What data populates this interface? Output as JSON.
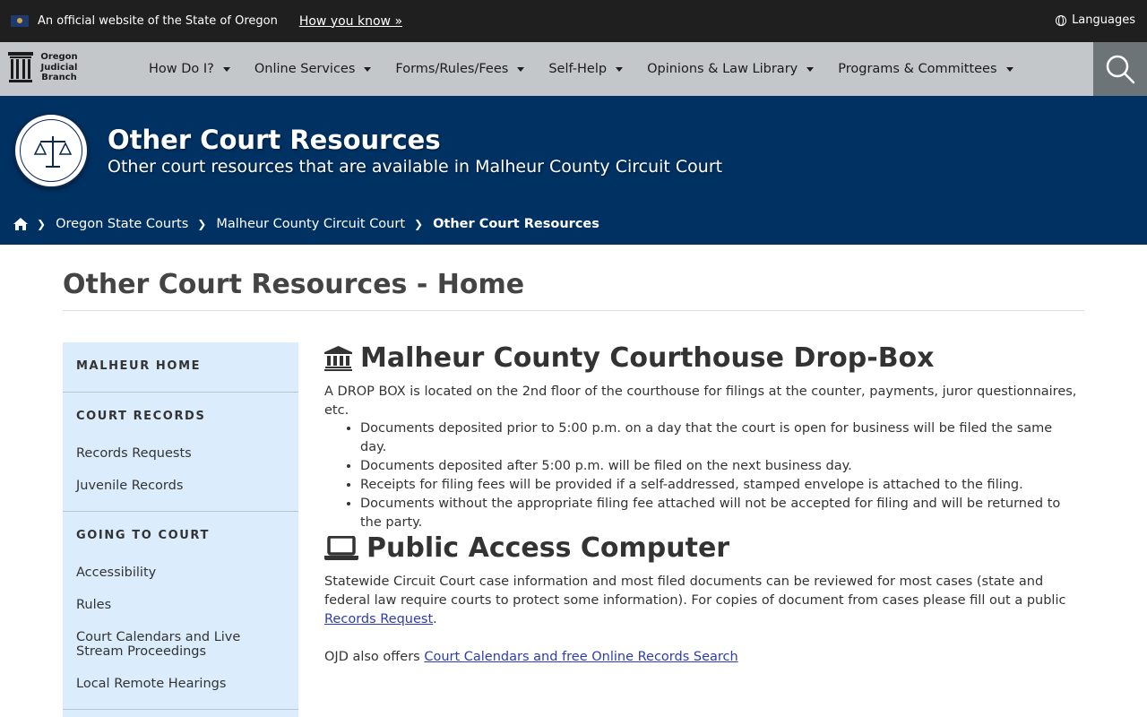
{
  "gov_bar": {
    "official_text": "An official website of the State of Oregon",
    "how_you_know": "How you know »",
    "languages": "Languages"
  },
  "logo": {
    "line1": "Oregon",
    "line2": "Judicial",
    "line3": "Branch"
  },
  "nav": {
    "items": [
      {
        "label": "How Do I?"
      },
      {
        "label": "Online Services"
      },
      {
        "label": "Forms/Rules/Fees"
      },
      {
        "label": "Self-Help"
      },
      {
        "label": "Opinions & Law Library"
      },
      {
        "label": "Programs & Committees"
      }
    ]
  },
  "banner": {
    "title": "Other Court Resources",
    "subtitle": "Other court resources that are available in Malheur County Circuit Court"
  },
  "breadcrumb": {
    "items": [
      {
        "label": "Oregon State Courts"
      },
      {
        "label": "Malheur County Circuit Court"
      }
    ],
    "current": "Other Court Resources"
  },
  "page": {
    "title": "Other Court Resources - Home"
  },
  "sidebar": {
    "home": "MALHEUR HOME",
    "court_records": "COURT RECORDS",
    "records_requests": "Records Requests",
    "juvenile_records": "Juvenile Records",
    "going_to_court": "GOING TO COURT",
    "accessibility": "Accessibility",
    "rules": "Rules",
    "calendars": "Court Calendars and Live Stream Proceedings",
    "remote_hearings": "Local Remote Hearings"
  },
  "dropbox": {
    "heading": "Malheur County Courthouse Drop-Box",
    "intro": "A DROP BOX is located on the 2nd floor of the courthouse for filings at the counter, payments, juror questionnaires, etc.",
    "bullets": [
      "Documents deposited prior to 5:00 p.m. on a day that the court is open for business will be filed the same day.",
      "Documents deposited after 5:00 p.m. will be filed on the next business day.",
      "Receipts for filing fees will be provided if a self-addressed, stamped envelope is attached to the filing.",
      "Documents without the appropriate filing fee attached will not be accepted for filing and will be returned to the party."
    ]
  },
  "computer": {
    "heading": "Public Access Computer",
    "text": "Statewide Circuit Court case information and most filed documents can be reviewed for most cases (state and federal law require courts to protect some information). For copies of document from cases please fill out a public",
    "link": "Records Request",
    "text_end": ".",
    "offers_prefix": "OJD also offers",
    "offers_link": "Court Calendars and free Online Records Search"
  }
}
